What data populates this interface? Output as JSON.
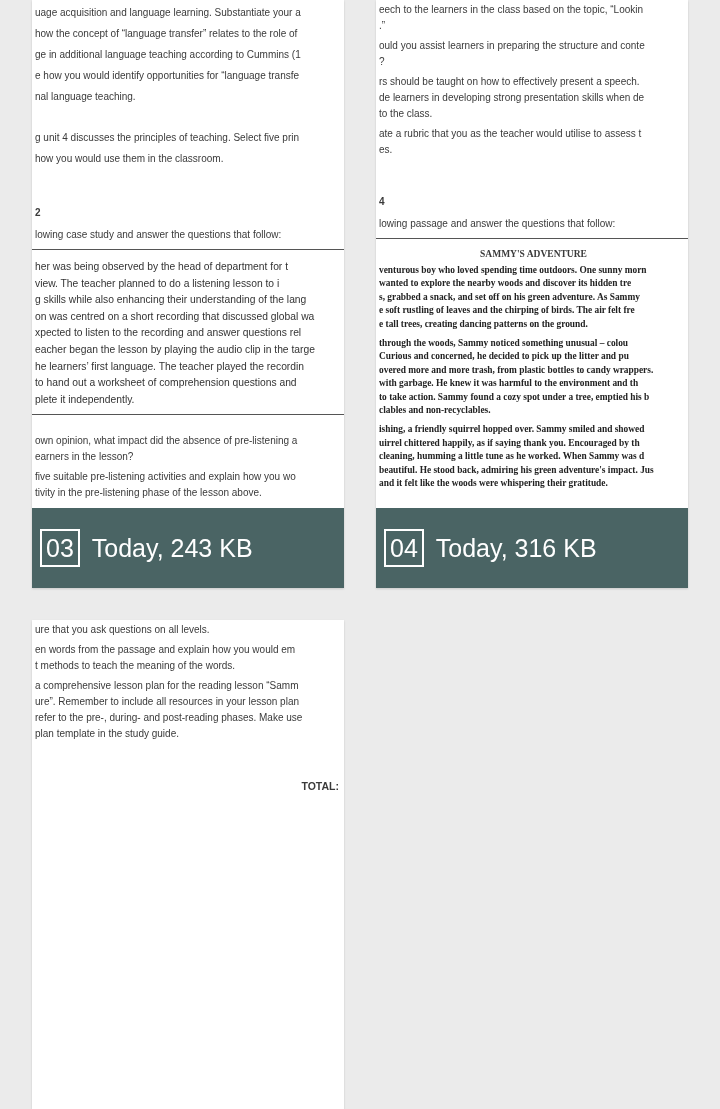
{
  "thumbnails": [
    {
      "number": "03",
      "caption": "Today, 243 KB",
      "blocks": [
        {
          "kind": "loose",
          "lines": [
            "uage acquisition and language learning. Substantiate your a",
            "how the concept of “language transfer” relates to the role of",
            "ge in additional language teaching according to Cummins (1",
            "e how you would identify opportunities for “language transfe",
            "nal language teaching."
          ]
        },
        {
          "kind": "loose",
          "lines": [
            "g unit 4 discusses the principles of teaching. Select five prin",
            "how you would use them in the classroom."
          ]
        },
        {
          "kind": "heading",
          "text": "2"
        },
        {
          "kind": "para",
          "lines": [
            "lowing case study and answer the questions that follow:"
          ]
        },
        {
          "kind": "rule"
        },
        {
          "kind": "case",
          "lines": [
            "her was being observed by the head of department for t",
            "view. The teacher planned to do a listening lesson to i",
            "g skills while also enhancing their understanding of the lang",
            "on was centred on a short recording that discussed global wa",
            "xpected to listen to the recording and answer questions rel",
            "eacher began the lesson by playing the audio clip in the targe",
            "he learners’ first language. The teacher played the recordin",
            "to hand out a worksheet of comprehension questions and",
            "plete it independently."
          ]
        },
        {
          "kind": "rule"
        },
        {
          "kind": "para",
          "lines": [
            "own opinion, what impact did the absence of pre-listening a",
            "earners in the lesson?"
          ]
        },
        {
          "kind": "para",
          "lines": [
            "five suitable pre-listening activities and explain how you wo",
            "tivity in the pre-listening phase of the lesson above."
          ]
        }
      ]
    },
    {
      "number": "04",
      "caption": "Today, 316 KB",
      "blocks": [
        {
          "kind": "para",
          "lines": [
            "eech to the learners in the class based on the topic, “Lookin",
            ".”"
          ]
        },
        {
          "kind": "para",
          "lines": [
            "ould you assist learners in preparing the structure and conte",
            "?"
          ]
        },
        {
          "kind": "para",
          "lines": [
            "rs should be taught on how to effectively present a speech.",
            "de learners in developing strong presentation skills when de",
            "to the class."
          ]
        },
        {
          "kind": "para",
          "lines": [
            "ate a rubric that you as the teacher would utilise to assess t",
            "es."
          ]
        },
        {
          "kind": "heading",
          "text": "4"
        },
        {
          "kind": "para",
          "lines": [
            "lowing passage and answer the questions that follow:"
          ]
        },
        {
          "kind": "rule"
        },
        {
          "kind": "title",
          "text": "SAMMY'S ADVENTURE"
        },
        {
          "kind": "passage",
          "lines": [
            "venturous boy who loved spending time outdoors. One sunny morn",
            "wanted to explore the nearby woods and discover its hidden tre",
            "s, grabbed a snack, and set off on his green adventure. As Sammy",
            "e soft rustling of leaves and the chirping of birds. The air felt fre",
            "e tall trees, creating dancing patterns on the ground."
          ]
        },
        {
          "kind": "passage",
          "lines": [
            "through the woods, Sammy noticed something unusual – colou",
            "Curious and concerned, he decided to pick up the litter and pu",
            "overed more and more trash, from plastic bottles to candy wrappers.",
            "with garbage. He knew it was harmful to the environment and th",
            "to take action. Sammy found a cozy spot under a tree, emptied his b",
            "clables and non-recyclables."
          ]
        },
        {
          "kind": "passage",
          "lines": [
            "ishing, a friendly squirrel hopped over. Sammy smiled and showed",
            "uirrel chittered happily, as if saying thank you. Encouraged by th",
            "cleaning, humming a little tune as he worked. When Sammy was d",
            "beautiful. He stood back, admiring his green adventure's impact. Jus",
            "and it felt like the woods were whispering their gratitude."
          ]
        }
      ]
    },
    {
      "blocks": [
        {
          "kind": "para",
          "lines": [
            "ure that you ask questions on all levels."
          ]
        },
        {
          "kind": "para",
          "lines": [
            "en words from the passage and explain how you would em",
            "t methods to teach the meaning of the words."
          ]
        },
        {
          "kind": "para",
          "lines": [
            "a comprehensive lesson plan for the reading lesson “Samm",
            "ure”. Remember to include all resources in your lesson plan",
            "refer to the pre-, during- and post-reading phases. Make use",
            "plan template in the study guide."
          ]
        },
        {
          "kind": "total",
          "text": "TOTAL:"
        }
      ]
    }
  ]
}
